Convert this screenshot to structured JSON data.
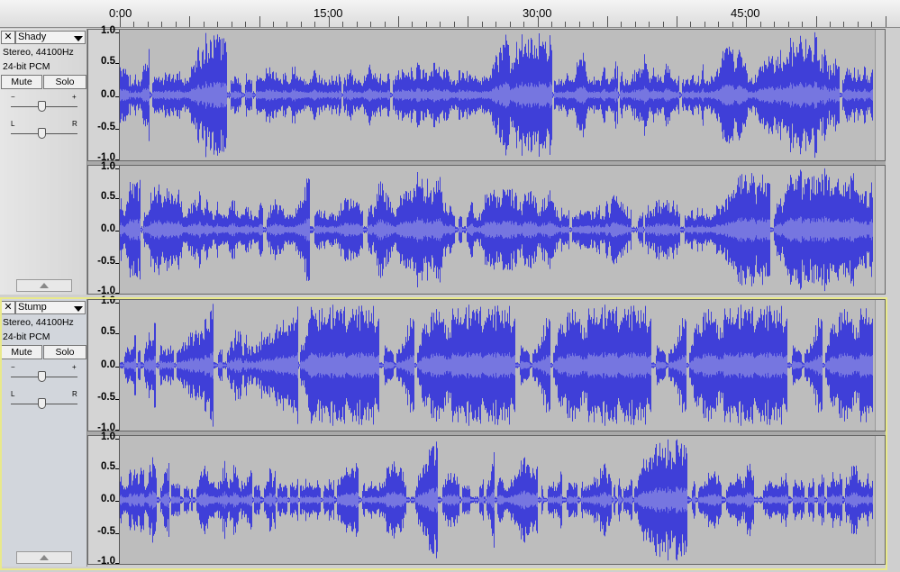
{
  "ruler": {
    "labels": [
      "0:00",
      "15:00",
      "30:00",
      "45:00"
    ]
  },
  "tracks": [
    {
      "name": "Shady",
      "format": "Stereo, 44100Hz",
      "bitdepth": "24-bit PCM",
      "mute_label": "Mute",
      "solo_label": "Solo",
      "gain_minus": "−",
      "gain_plus": "+",
      "pan_left": "L",
      "pan_right": "R",
      "selected": false
    },
    {
      "name": "Stump",
      "format": "Stereo, 44100Hz",
      "bitdepth": "24-bit PCM",
      "mute_label": "Mute",
      "solo_label": "Solo",
      "gain_minus": "−",
      "gain_plus": "+",
      "pan_left": "L",
      "pan_right": "R",
      "selected": true
    }
  ],
  "amplitude_labels": [
    "1.0",
    "0.5",
    "0.0",
    "-0.5",
    "-1.0"
  ],
  "colors": {
    "wave": "#3f3fd8",
    "wave_rms": "#7676e0",
    "background": "#bdbdbd",
    "selection": "#e9e98a"
  },
  "icons": {
    "close": "close-icon",
    "menu": "chevron-down-icon",
    "collapse": "collapse-arrow-icon"
  }
}
